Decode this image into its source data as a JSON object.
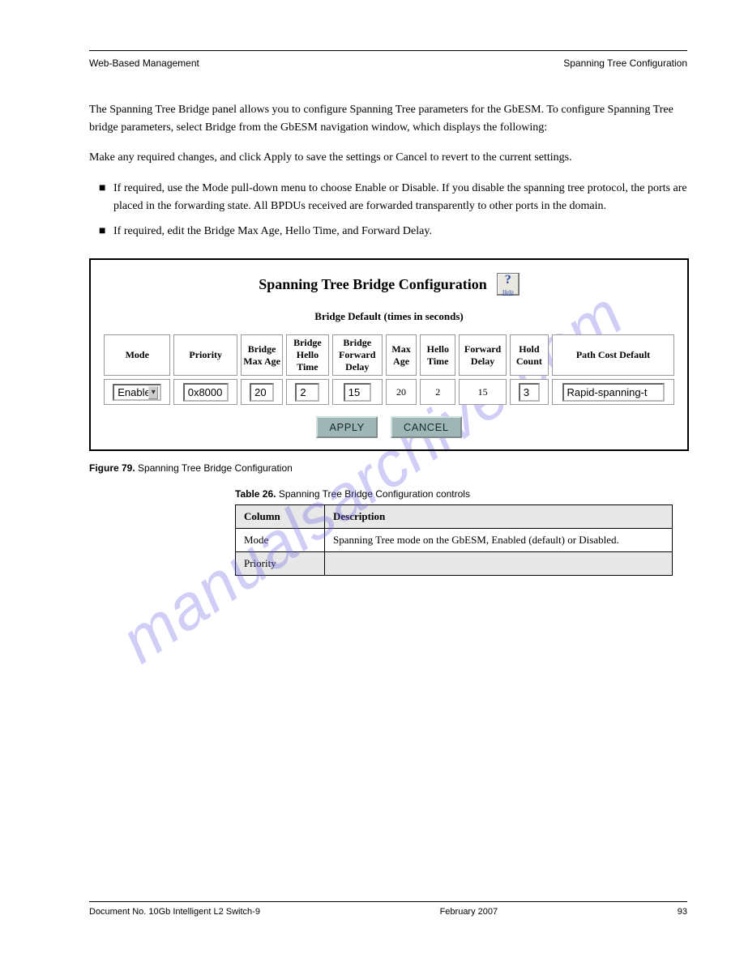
{
  "header": {
    "left": "Web-Based Management",
    "right": "Spanning Tree Configuration"
  },
  "watermark": "manualsarchive.com",
  "paragraphs": {
    "intro": "The Spanning Tree Bridge panel allows you to configure Spanning Tree parameters for the GbESM. To configure Spanning Tree bridge parameters, select Bridge from the GbESM navigation window, which displays the following:",
    "before_list": "Make any required changes, and click Apply to save the settings or Cancel to revert to the current settings.",
    "list_1": "If required, use the Mode pull-down menu to choose Enable or Disable. If you disable the spanning tree protocol, the ports are placed in the forwarding state. All BPDUs received are forwarded transparently to other ports in the domain.",
    "list_2": "If required, edit the Bridge Max Age, Hello Time, and Forward Delay."
  },
  "screenshot": {
    "title": "Spanning Tree Bridge Configuration",
    "help_label": "Help",
    "subtitle": "Bridge Default (times in seconds)",
    "headers": [
      "Mode",
      "Priority",
      "Bridge Max Age",
      "Bridge Hello Time",
      "Bridge Forward Delay",
      "Max Age",
      "Hello Time",
      "Forward Delay",
      "Hold Count",
      "Path Cost Default"
    ],
    "values": {
      "mode": "Enable",
      "priority": "0x8000",
      "bridge_max_age": "20",
      "bridge_hello_time": "2",
      "bridge_forward_delay": "15",
      "max_age": "20",
      "hello_time": "2",
      "forward_delay": "15",
      "hold_count": "3",
      "path_cost_default": "Rapid-spanning-t"
    },
    "buttons": {
      "apply": "APPLY",
      "cancel": "CANCEL"
    }
  },
  "captions": {
    "figure_num": "Figure 79.",
    "figure_text": "Spanning Tree Bridge Configuration",
    "table_num": "Table 26.",
    "table_text": "Spanning Tree Bridge Configuration controls"
  },
  "col_table": {
    "h1": "Column",
    "h2": "Description",
    "r1c1": "Mode",
    "r1c2": "Spanning Tree mode on the GbESM, Enabled (default) or Disabled.",
    "r2c1": "Priority",
    "r2c2": ""
  },
  "footer": {
    "left": "Document No. 10Gb Intelligent L2 Switch-9",
    "center": "February 2007",
    "right": "93"
  }
}
